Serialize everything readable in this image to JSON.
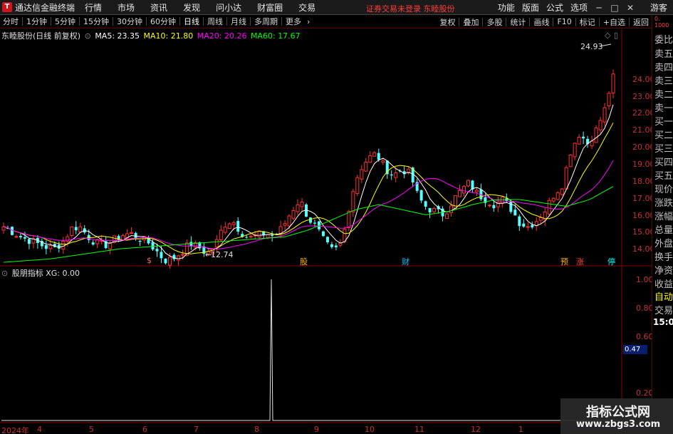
{
  "menubar": {
    "app_title": "通达信金融终端",
    "logo_glyph": "T",
    "menus": [
      "行情",
      "市场",
      "资讯",
      "发现",
      "问小达",
      "财富圈",
      "交易"
    ],
    "notice": "证券交易未登录  东睦股份",
    "right_menus": [
      "功能",
      "版面",
      "公式",
      "选项"
    ],
    "guest": "游客"
  },
  "toolbar": {
    "periods": [
      "分时",
      "1分钟",
      "5分钟",
      "15分钟",
      "30分钟",
      "60分钟",
      "日线",
      "周线",
      "月线",
      "多周期",
      "更多"
    ],
    "active_period": "日线",
    "right_buttons": [
      "复权",
      "叠加",
      "多股",
      "统计",
      "画线",
      "F10",
      "标记",
      "+自选",
      "返回"
    ]
  },
  "main_chart": {
    "title": "东睦股份(日线 前复权)",
    "ma": [
      {
        "label": "MA5: 23.35",
        "color": "#ffffff"
      },
      {
        "label": "MA10: 21.80",
        "color": "#ffff00"
      },
      {
        "label": "MA20: 20.26",
        "color": "#ff00ff"
      },
      {
        "label": "MA60: 17.67",
        "color": "#00ff00"
      }
    ],
    "high_label": "24.93",
    "low_label": "12.74",
    "y_ticks": [
      "24.00",
      "23.00",
      "22.00",
      "21.00",
      "20.00",
      "19.00",
      "18.00",
      "17.00",
      "16.00",
      "15.00",
      "14.00"
    ],
    "event_marks": [
      {
        "text": "$",
        "color": "#ff6060"
      },
      {
        "text": "股",
        "color": "#ffb000"
      },
      {
        "text": "财",
        "color": "#00c0ff"
      },
      {
        "text": "预",
        "color": "#ffb000"
      },
      {
        "text": "涨",
        "color": "#ff4040"
      },
      {
        "text": "停",
        "color": "#00ffff"
      }
    ]
  },
  "indicator": {
    "title": "股朋指标  XG: 0.00",
    "y_ticks": [
      "1.00",
      "0.80",
      "0.60",
      "0.20"
    ],
    "cursor_value": "0.47"
  },
  "x_axis": {
    "labels": [
      "2024年",
      "4",
      "5",
      "6",
      "7",
      "8",
      "9",
      "10",
      "11",
      "12",
      "1"
    ]
  },
  "quote_panel": {
    "code": "0.",
    "code_lines": [
      "0.",
      "1000"
    ],
    "items": [
      "委比",
      "卖五",
      "卖四",
      "卖三",
      "卖二",
      "卖一",
      "买一",
      "买二",
      "买三",
      "买四",
      "买五",
      "现价",
      "涨跌",
      "涨幅",
      "总量",
      "外盘",
      "换手",
      "净资",
      "收益"
    ],
    "auto": "自动",
    "trade": "交易",
    "time": "15:00"
  },
  "watermark": {
    "line1": "指标公式网",
    "line2": "www.zbgs3.com"
  },
  "colors": {
    "frame": "#8b0000",
    "axis_text": "#c83232",
    "up": "#ff3232",
    "down": "#54ffff",
    "ma5": "#ffffff",
    "ma10": "#ffff00",
    "ma20": "#ff00ff",
    "ma60": "#00ff00"
  },
  "chart_data": {
    "type": "candlestick",
    "price_range": [
      12.7,
      25.0
    ],
    "x_labels": [
      "2024年",
      "4",
      "5",
      "6",
      "7",
      "8",
      "9",
      "10",
      "11",
      "12",
      "1"
    ],
    "close_path": [
      15.3,
      15.0,
      14.7,
      14.5,
      14.3,
      14.1,
      14.0,
      14.4,
      15.2,
      15.3,
      14.7,
      14.3,
      14.2,
      14.5,
      14.8,
      14.9,
      14.6,
      14.4,
      13.9,
      13.3,
      13.4,
      13.8,
      14.3,
      14.1,
      13.7,
      14.2,
      15.4,
      15.7,
      15.0,
      14.6,
      14.8,
      14.9,
      14.7,
      15.3,
      16.2,
      16.9,
      15.8,
      15.2,
      14.3,
      13.8,
      14.4,
      17.0,
      18.6,
      19.3,
      19.6,
      18.8,
      18.3,
      18.7,
      18.4,
      17.0,
      16.4,
      16.2,
      16.0,
      16.8,
      17.4,
      17.9,
      17.2,
      16.9,
      16.6,
      16.9,
      16.3,
      15.5,
      15.3,
      15.7,
      16.3,
      17.2,
      17.8,
      19.8,
      20.8,
      20.2,
      21.0,
      22.2,
      24.3
    ],
    "ma60_path": [
      13.2,
      13.3,
      13.4,
      13.6,
      13.8,
      14.0,
      14.1,
      14.2,
      14.3,
      14.4,
      14.5,
      14.6,
      14.7,
      15.1,
      15.7,
      16.3,
      16.6,
      16.3,
      16.0,
      16.2,
      16.6,
      16.9,
      16.9,
      16.7,
      16.5,
      16.9,
      17.67
    ],
    "indicator_xg": {
      "spike_value": 1.0,
      "baseline": 0.0,
      "current": 0.0
    }
  }
}
